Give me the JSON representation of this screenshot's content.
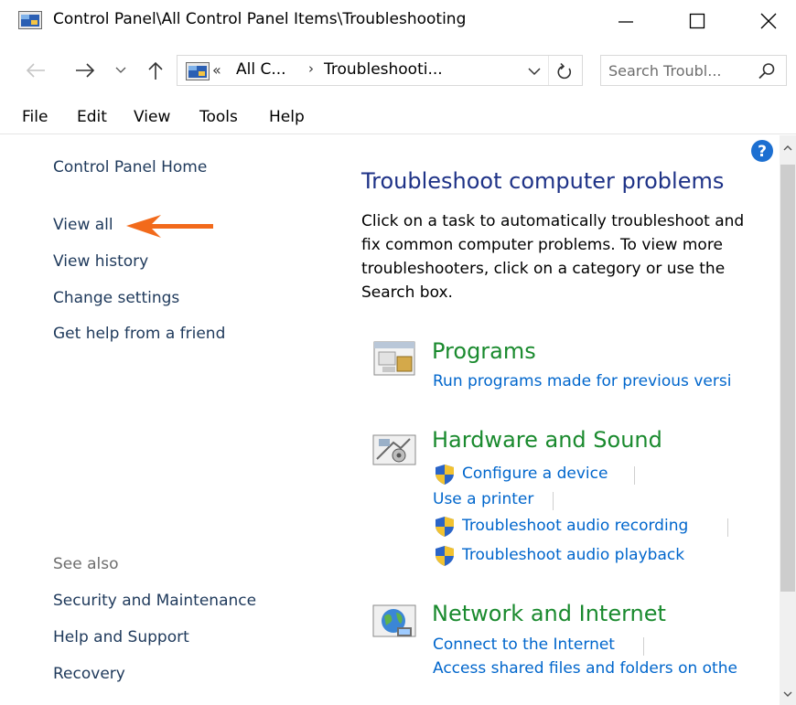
{
  "window": {
    "title": "Control Panel\\All Control Panel Items\\Troubleshooting"
  },
  "address": {
    "chevrons": "«",
    "segment1": "All C...",
    "separator": "›",
    "segment2": "Troubleshooti..."
  },
  "search": {
    "placeholder": "Search Troubl..."
  },
  "menu": {
    "file": "File",
    "edit": "Edit",
    "view": "View",
    "tools": "Tools",
    "help": "Help"
  },
  "left_pane": {
    "home": "Control Panel Home",
    "view_all": "View all",
    "view_history": "View history",
    "change_settings": "Change settings",
    "get_help": "Get help from a friend",
    "see_also": "See also",
    "security": "Security and Maintenance",
    "help_support": "Help and Support",
    "recovery": "Recovery"
  },
  "main": {
    "title": "Troubleshoot computer problems",
    "description": "Click on a task to automatically troubleshoot and fix common computer problems. To view more troubleshooters, click on a category or use the Search box."
  },
  "categories": {
    "programs": {
      "title": "Programs",
      "task1": "Run programs made for previous versi"
    },
    "hardware": {
      "title": "Hardware and Sound",
      "task1": "Configure a device",
      "task2": "Use a printer",
      "task3": "Troubleshoot audio recording",
      "task4": "Troubleshoot audio playback"
    },
    "network": {
      "title": "Network and Internet",
      "task1": "Connect to the Internet",
      "task2": "Access shared files and folders on othe"
    }
  },
  "colors": {
    "link_dark": "#1e395b",
    "link_blue": "#0066cc",
    "category_green": "#1a8a2e",
    "title_blue": "#1e3287",
    "annotation_arrow": "#f26a1b"
  },
  "icons": {
    "app": "control-panel-icon",
    "help": "help-icon",
    "search": "search-icon",
    "shield": "uac-shield-icon"
  }
}
